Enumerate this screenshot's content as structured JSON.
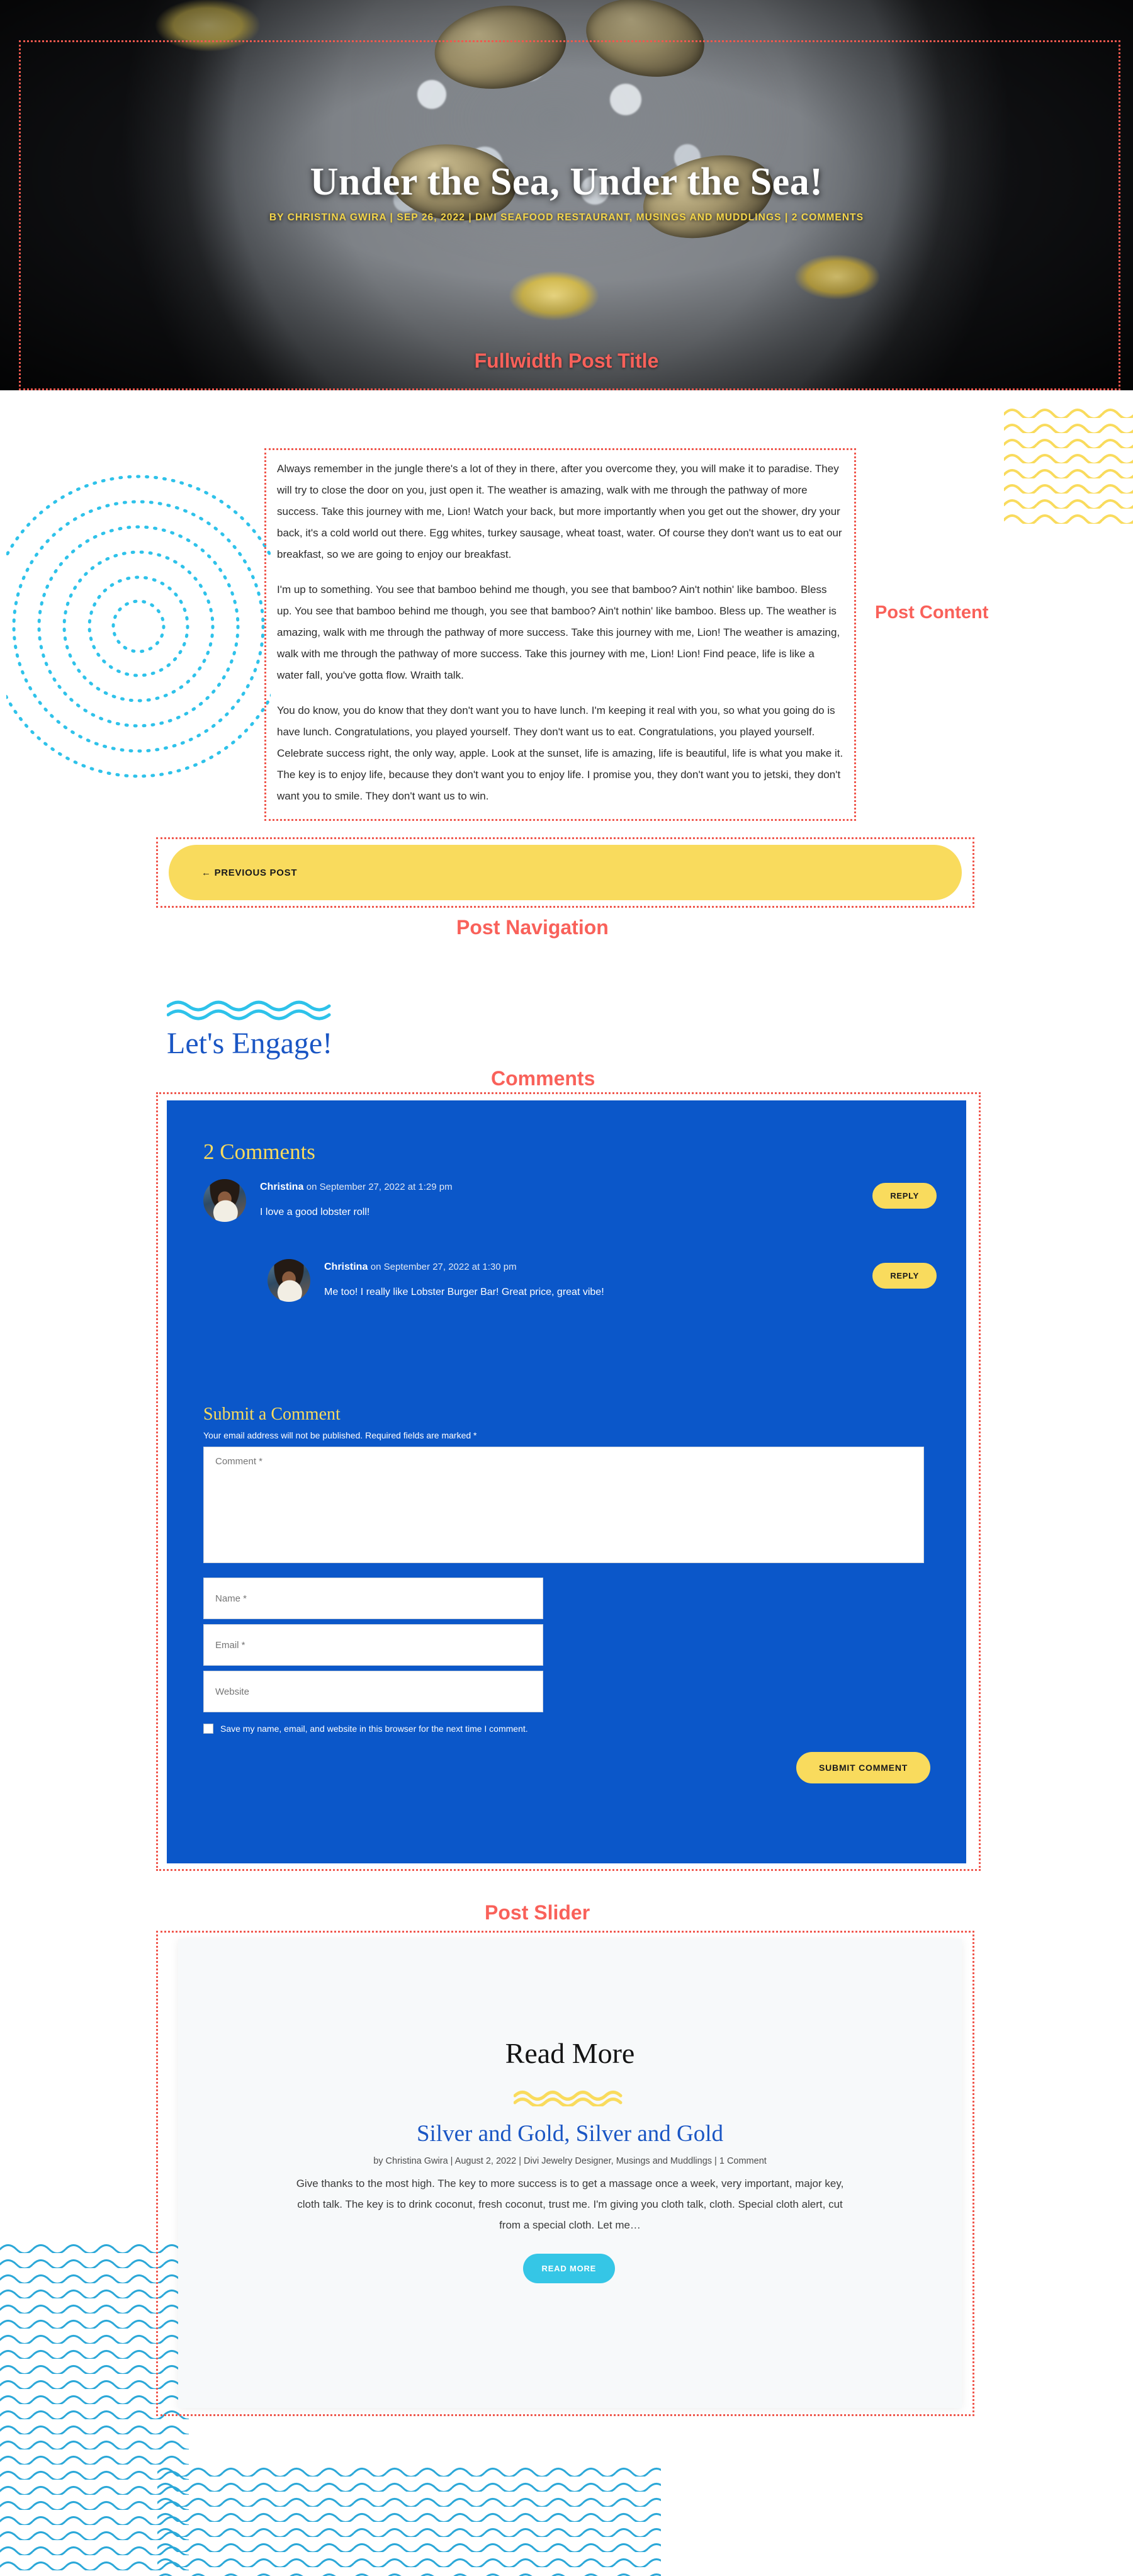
{
  "colors": {
    "accent_red": "#f9615a",
    "brand_blue": "#0b57c9",
    "heading_blue": "#1a56c4",
    "yellow": "#f9db5d",
    "cyan": "#35c6e6",
    "hero_meta_yellow": "#f4d54a"
  },
  "hero": {
    "title": "Under the Sea, Under the Sea!",
    "meta": "BY CHRISTINA GWIRA | SEP 26, 2022 | DIVI SEAFOOD RESTAURANT, MUSINGS AND MUDDLINGS | 2 COMMENTS",
    "module_label": "Fullwidth Post Title"
  },
  "post_content": {
    "module_label": "Post Content",
    "paragraphs": [
      "Always remember in the jungle there's a lot of they in there, after you overcome they, you will make it to paradise. They will try to close the door on you, just open it. The weather is amazing, walk with me through the pathway of more success. Take this journey with me, Lion! Watch your back, but more importantly when you get out the shower, dry your back, it's a cold world out there. Egg whites, turkey sausage, wheat toast, water. Of course they don't want us to eat our breakfast, so we are going to enjoy our breakfast.",
      "I'm up to something. You see that bamboo behind me though, you see that bamboo? Ain't nothin' like bamboo. Bless up. You see that bamboo behind me though, you see that bamboo? Ain't nothin' like bamboo. Bless up. The weather is amazing, walk with me through the pathway of more success. Take this journey with me, Lion! The weather is amazing, walk with me through the pathway of more success. Take this journey with me, Lion! Lion! Find peace, life is like a water fall, you've gotta flow. Wraith talk.",
      "You do know, you do know that they don't want you to have lunch. I'm keeping it real with you, so what you going do is have lunch. Congratulations, you played yourself. They don't want us to eat. Congratulations, you played yourself. Celebrate success right, the only way, apple. Look at the sunset, life is amazing, life is beautiful, life is what you make it. The key is to enjoy life, because they don't want you to enjoy life. I promise you, they don't want you to jetski, they don't want you to smile. They don't want us to win."
    ]
  },
  "post_navigation": {
    "module_label": "Post Navigation",
    "previous_label": "← PREVIOUS POST"
  },
  "engage": {
    "title": "Let's Engage!"
  },
  "comments": {
    "module_label": "Comments",
    "count_heading": "2 Comments",
    "items": [
      {
        "author": "Christina",
        "when": "on September 27, 2022 at 1:29 pm",
        "body": "I love a good lobster roll!",
        "reply_label": "REPLY"
      },
      {
        "author": "Christina",
        "when": "on September 27, 2022 at 1:30 pm",
        "body": "Me too! I really like Lobster Burger Bar! Great price, great vibe!",
        "reply_label": "REPLY"
      }
    ],
    "form": {
      "heading": "Submit a Comment",
      "notice": "Your email address will not be published. Required fields are marked *",
      "comment_placeholder": "Comment *",
      "name_placeholder": "Name *",
      "email_placeholder": "Email *",
      "website_placeholder": "Website",
      "save_label": "Save my name, email, and website in this browser for the next time I comment.",
      "submit_label": "SUBMIT COMMENT"
    }
  },
  "post_slider": {
    "module_label": "Post Slider",
    "heading": "Read More",
    "slide": {
      "title": "Silver and Gold, Silver and Gold",
      "meta": "by Christina Gwira | August 2, 2022 | Divi Jewelry Designer, Musings and Muddlings | 1 Comment",
      "excerpt": "Give thanks to the most high. The key to more success is to get a massage once a week, very important, major key, cloth talk. The key is to drink coconut, fresh coconut, trust me. I'm giving you cloth talk, cloth. Special cloth alert, cut from a special cloth. Let me…",
      "button_label": "READ MORE"
    }
  }
}
